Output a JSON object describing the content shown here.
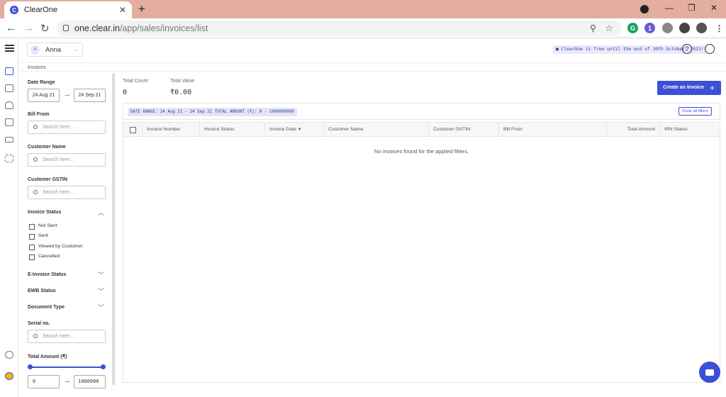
{
  "browser": {
    "tab_title": "ClearOne",
    "tab_icon_letter": "C",
    "url_host": "one.clear.in",
    "url_path": "/app/sales/invoices/list",
    "extension_badge": "1"
  },
  "header": {
    "user": {
      "initial": "A",
      "name": "Anna"
    },
    "promo": "ClearOne is free until the end of 30th October, 2021!",
    "help_icon": "?"
  },
  "breadcrumb": "Invoices",
  "filters": {
    "date_range": {
      "label": "Date Range",
      "from": "24 Aug 21",
      "to": "24 Sep 21"
    },
    "bill_from": {
      "label": "Bill From",
      "placeholder": "Search here..."
    },
    "customer_name": {
      "label": "Customer Name",
      "placeholder": "Search here..."
    },
    "customer_gstin": {
      "label": "Customer GSTIN",
      "placeholder": "Search here..."
    },
    "invoice_status": {
      "label": "Invoice Status",
      "options": [
        "Not Sent",
        "Sent",
        "Viewed by Customer",
        "Cancelled"
      ]
    },
    "einvoice_status": {
      "label": "E-Invoice Status"
    },
    "ewb_status": {
      "label": "EWB Status"
    },
    "document_type": {
      "label": "Document Type"
    },
    "serial_no": {
      "label": "Serial no.",
      "placeholder": "Search here..."
    },
    "total_amount": {
      "label": "Total Amount (₹)",
      "min": "0",
      "max": "1000000",
      "slider_min": 0,
      "slider_max": 1
    }
  },
  "stats": {
    "count_label": "Total Count",
    "count_value": "0",
    "value_label": "Total Value",
    "value_value": "₹0.00"
  },
  "actions": {
    "create": "Create an Invoice",
    "clear_all": "Clear all filters"
  },
  "chips": [
    "DATE RANGE: 24 Aug 21 - 24 Sep 21",
    "TOTAL AMOUNT (₹): 0 - 1000000000"
  ],
  "table": {
    "columns": [
      "Invoice Number",
      "Invoice Status",
      "Invoice Date",
      "Customer Name",
      "Customer GSTIN",
      "Bill From",
      "Total Amount",
      "IRN Status"
    ],
    "sort_indicator": "▼",
    "empty_message": "No invoices found for the applied filters."
  },
  "colors": {
    "accent": "#3c50d6",
    "tabbar": "#e3ad9f"
  },
  "icons": [
    "menu-icon",
    "sales-icon",
    "truck-icon",
    "users-icon",
    "building-icon",
    "wallet-icon",
    "sliders-icon",
    "logout-icon",
    "help-icon",
    "profile-icon",
    "chat-icon"
  ]
}
